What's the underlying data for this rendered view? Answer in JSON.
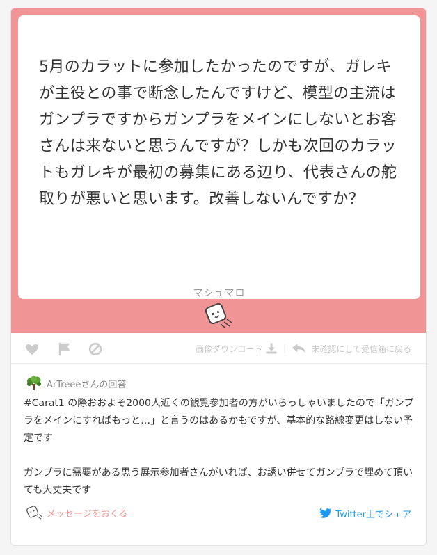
{
  "question": {
    "text": "5月のカラットに参加したかったのですが、ガレキが主役との事で断念したんですけど、模型の主流はガンプラですからガンプラをメインにしないとお客さんは来ないと思うんですが？しかも次回のカラットもガレキが最初の募集にある辺り、代表さんの舵取りが悪いと思います。改善しないんですか？",
    "brand": "マシュマロ"
  },
  "actions": {
    "icons": [
      "heart-icon",
      "flag-icon",
      "block-icon"
    ],
    "download_label": "画像ダウンロード",
    "separator": "|",
    "return_label": "未確認にして受信箱に戻る"
  },
  "answer": {
    "author_line": "ArTreeeさんの回答",
    "paragraph1": "#Carat1 の際おおよそ2000人近くの観覧参加者の方がいらっしゃいましたので「ガンプラをメインにすればもっと…」と言うのはあるかもですが、基本的な路線変更はしない予定です",
    "paragraph2": "ガンプラに需要がある思う展示参加者さんがいれば、お誘い併せてガンプラで埋めて頂いても大丈夫です"
  },
  "footer": {
    "send_message_label": "メッセージをおくる",
    "share_label": "Twitter上でシェア"
  },
  "colors": {
    "brand_pink": "#f19496",
    "twitter_blue": "#1d9bf0",
    "icon_gray": "#cccccc"
  }
}
